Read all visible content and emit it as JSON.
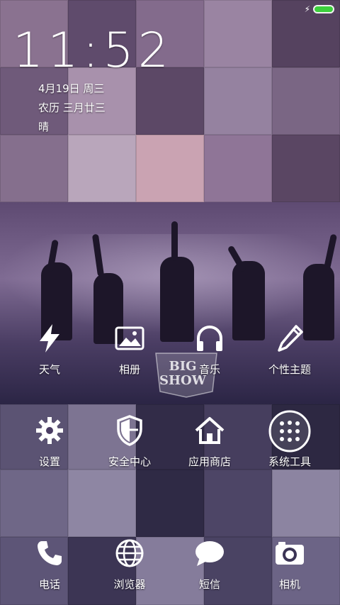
{
  "status_bar": {
    "charging_icon": "bolt-icon",
    "battery_color": "#3ccf3c"
  },
  "lockscreen": {
    "time": "11:52",
    "date": "4月19日 周三",
    "lunar": "农历 三月廿三",
    "weather": "晴"
  },
  "watermark_logo": {
    "line1": "BIG",
    "line2": "SHOW"
  },
  "apps": {
    "row1": [
      {
        "label": "天气",
        "icon": "lightning-icon"
      },
      {
        "label": "相册",
        "icon": "gallery-icon"
      },
      {
        "label": "音乐",
        "icon": "headphones-icon"
      },
      {
        "label": "个性主题",
        "icon": "brush-icon"
      }
    ],
    "row2": [
      {
        "label": "设置",
        "icon": "gear-icon"
      },
      {
        "label": "安全中心",
        "icon": "shield-icon"
      },
      {
        "label": "应用商店",
        "icon": "home-icon"
      },
      {
        "label": "系统工具",
        "icon": "tools-folder-icon"
      }
    ],
    "dock": [
      {
        "label": "电话",
        "icon": "phone-icon"
      },
      {
        "label": "浏览器",
        "icon": "globe-icon"
      },
      {
        "label": "短信",
        "icon": "message-icon"
      },
      {
        "label": "相机",
        "icon": "camera-icon"
      }
    ]
  }
}
